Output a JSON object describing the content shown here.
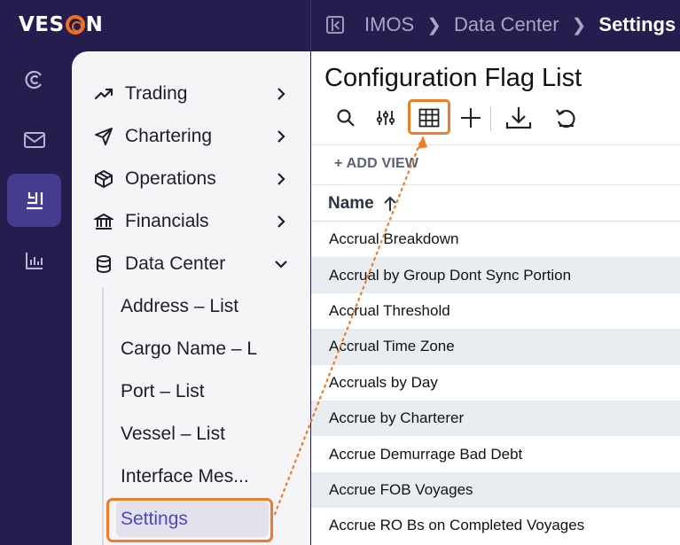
{
  "brand": {
    "name_left": "VES",
    "name_right": "N"
  },
  "breadcrumb": {
    "items": [
      "IMOS",
      "Data Center"
    ],
    "current": "Settings"
  },
  "rail": {
    "icons": [
      "vessel-c-icon",
      "mail-icon",
      "reports-icon",
      "chart-icon"
    ],
    "active_index": 2
  },
  "nav": {
    "items": [
      {
        "label": "Trading",
        "icon": "trending-icon",
        "chevron": ">"
      },
      {
        "label": "Chartering",
        "icon": "send-icon",
        "chevron": ">"
      },
      {
        "label": "Operations",
        "icon": "box-icon",
        "chevron": ">"
      },
      {
        "label": "Financials",
        "icon": "bank-icon",
        "chevron": ">"
      },
      {
        "label": "Data Center",
        "icon": "database-icon",
        "chevron": "v"
      }
    ],
    "subitems": [
      "Address – List",
      "Cargo Name – L",
      "Port – List",
      "Vessel – List",
      "Interface Mes...",
      "Settings"
    ],
    "active_subitem": "Settings"
  },
  "page": {
    "title": "Configuration Flag List",
    "toolbar": [
      "search-icon",
      "filter-sliders-icon",
      "grid-icon",
      "plus-icon",
      "download-icon",
      "undo-icon"
    ],
    "add_view": "+ ADD VIEW",
    "column": "Name",
    "sort": "ascending",
    "rows": [
      "Accrual Breakdown",
      "Accrual by Group Dont Sync Portion",
      "Accrual Threshold",
      "Accrual Time Zone",
      "Accruals by Day",
      "Accrue by Charterer",
      "Accrue Demurrage Bad Debt",
      "Accrue FOB Voyages",
      "Accrue RO Bs on Completed Voyages"
    ]
  },
  "colors": {
    "accent": "#f07c2a",
    "sidebar": "#241d4d",
    "active": "#453c90",
    "link": "#4c47c2"
  }
}
